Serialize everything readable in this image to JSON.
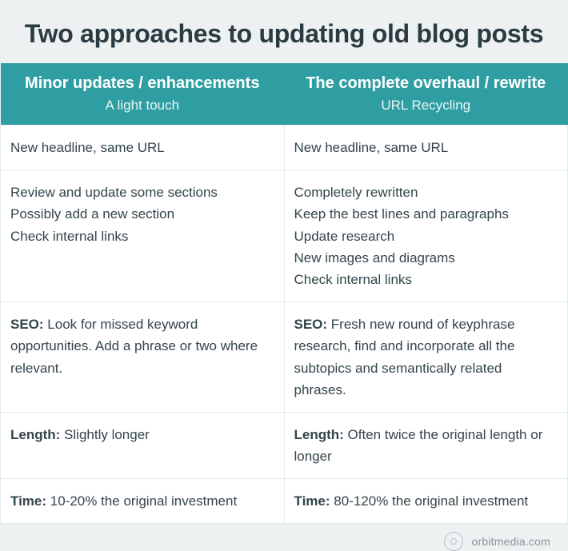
{
  "title": "Two approaches to updating old blog posts",
  "columns": {
    "left": {
      "heading": "Minor updates / enhancements",
      "sub": "A light touch"
    },
    "right": {
      "heading": "The complete overhaul / rewrite",
      "sub": "URL Recycling"
    }
  },
  "rows": {
    "r1": {
      "left": "New headline, same URL",
      "right": "New headline, same URL"
    },
    "r2": {
      "left_lines": [
        "Review and update some sections",
        "Possibly add a new section",
        "Check internal links"
      ],
      "right_lines": [
        "Completely rewritten",
        "Keep the best lines and paragraphs",
        "Update research",
        "New images and diagrams",
        "Check internal links"
      ]
    },
    "r3": {
      "left_label": "SEO:",
      "left_text": " Look for missed keyword opportunities. Add a phrase or two where relevant.",
      "right_label": "SEO:",
      "right_text": " Fresh new round of keyphrase research, find and incorporate all the subtopics and semantically related phrases."
    },
    "r4": {
      "left_label": "Length:",
      "left_text": " Slightly longer",
      "right_label": "Length:",
      "right_text": " Often twice the original length or longer"
    },
    "r5": {
      "left_label": "Time:",
      "left_text": " 10-20% the original investment",
      "right_label": "Time:",
      "right_text": " 80-120% the original investment"
    }
  },
  "footer": {
    "text": "orbitmedia.com"
  },
  "chart_data": {
    "type": "table",
    "title": "Two approaches to updating old blog posts",
    "columns": [
      "Minor updates / enhancements — A light touch",
      "The complete overhaul / rewrite — URL Recycling"
    ],
    "rows": [
      [
        "New headline, same URL",
        "New headline, same URL"
      ],
      [
        "Review and update some sections; Possibly add a new section; Check internal links",
        "Completely rewritten; Keep the best lines and paragraphs; Update research; New images and diagrams; Check internal links"
      ],
      [
        "SEO: Look for missed keyword opportunities. Add a phrase or two where relevant.",
        "SEO: Fresh new round of keyphrase research, find and incorporate all the subtopics and semantically related phrases."
      ],
      [
        "Length: Slightly longer",
        "Length: Often twice the original length or longer"
      ],
      [
        "Time: 10-20% the original investment",
        "Time: 80-120% the original investment"
      ]
    ]
  }
}
